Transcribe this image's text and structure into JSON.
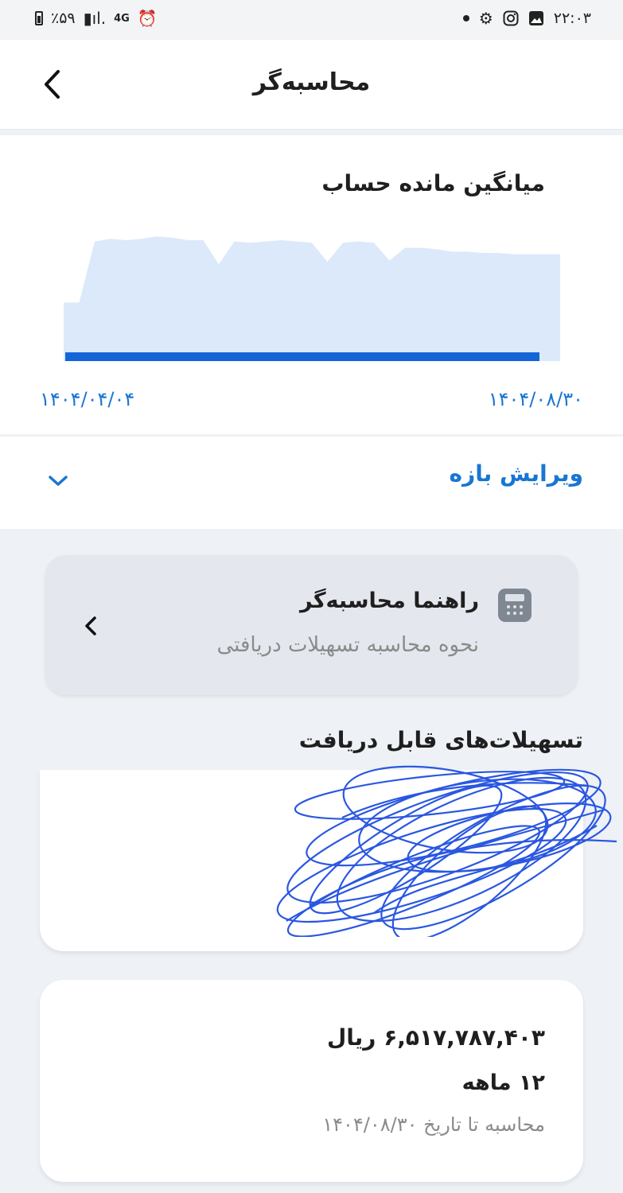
{
  "status_bar": {
    "battery_text": "٪۵۹",
    "network_text": "4G",
    "time": "۲۲:۰۳"
  },
  "header": {
    "title": "محاسبه‌گر"
  },
  "chart_card": {
    "title": "میانگین مانده حساب",
    "start_date": "۱۴۰۴/۰۴/۰۴",
    "end_date": "۱۴۰۴/۰۸/۳۰"
  },
  "chart_data": {
    "type": "area",
    "title": "میانگین مانده حساب",
    "x_start": "۱۴۰۴/۰۴/۰۴",
    "x_end": "۱۴۰۴/۰۸/۳۰",
    "values": [
      0.46,
      0.46,
      0.94,
      0.96,
      0.95,
      0.96,
      0.98,
      0.97,
      0.95,
      0.95,
      0.76,
      0.94,
      0.93,
      0.94,
      0.95,
      0.94,
      0.93,
      0.78,
      0.93,
      0.94,
      0.93,
      0.79,
      0.89,
      0.89,
      0.88,
      0.86,
      0.86,
      0.85,
      0.85,
      0.84,
      0.84,
      0.84,
      0.84
    ],
    "fill_color": "#dbe9fa",
    "line_color": "#1565d8"
  },
  "range": {
    "label": "ویرایش بازه"
  },
  "guide": {
    "title": "راهنما محاسبه‌گر",
    "subtitle": "نحوه محاسبه تسهیلات دریافتی"
  },
  "facilities": {
    "section_title": "تسهیلات‌های قابل دریافت",
    "items": [
      {
        "amount": "۶,۵۱۷,۷۸۷,۴۰۳ ریال",
        "months": "۱۲ ماهه",
        "calc_date": "محاسبه تا تاریخ ۱۴۰۴/۰۸/۳۰"
      }
    ]
  },
  "colors": {
    "accent": "#1976d2",
    "scribble": "#1f4fe0"
  }
}
